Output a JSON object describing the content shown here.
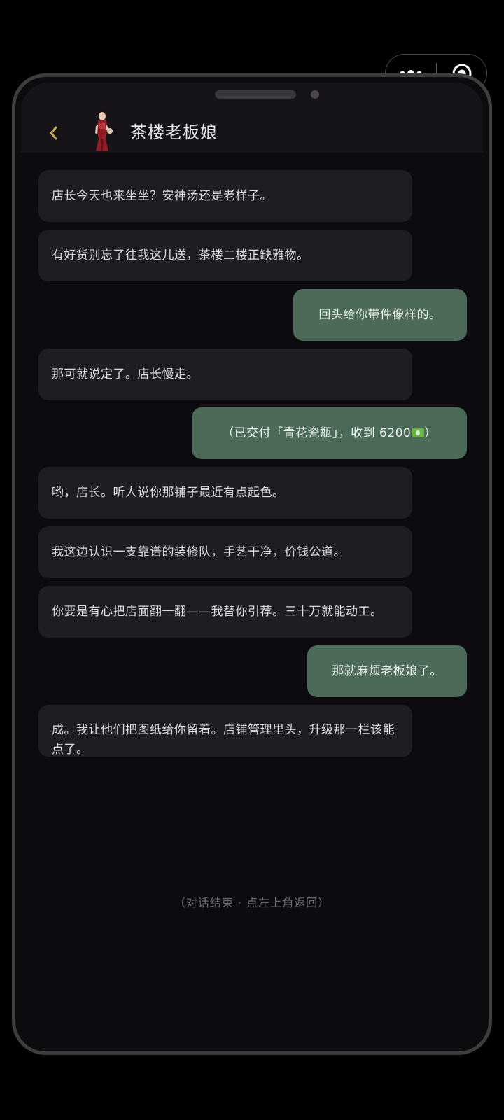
{
  "header": {
    "title": "茶楼老板娘"
  },
  "messages": [
    {
      "side": "left",
      "text": "店长今天也来坐坐？安神汤还是老样子。"
    },
    {
      "side": "left",
      "text": "有好货别忘了往我这儿送，茶楼二楼正缺雅物。"
    },
    {
      "side": "right",
      "text": "回头给你带件像样的。"
    },
    {
      "side": "left",
      "text": "那可就说定了。店长慢走。"
    },
    {
      "side": "right",
      "text": "（已交付「青花瓷瓶」，收到 6200",
      "icon": "money-icon",
      "text_after": "）"
    },
    {
      "side": "left",
      "text": "哟，店长。听人说你那铺子最近有点起色。"
    },
    {
      "side": "left",
      "text": "我这边认识一支靠谱的装修队，手艺干净，价钱公道。"
    },
    {
      "side": "left",
      "text": "你要是有心把店面翻一翻——我替你引荐。三十万就能动工。"
    },
    {
      "side": "right",
      "text": "那就麻烦老板娘了。"
    },
    {
      "side": "left",
      "text": "成。我让他们把图纸给你留着。店铺管理里头，升级那一栏该能点了。"
    }
  ],
  "end_note": "（对话结束 · 点左上角返回）",
  "colors": {
    "background": "#0d0b0f",
    "header": "#161418",
    "left_bubble": "#1f1d21",
    "right_bubble": "#4b6a57",
    "back_arrow": "#c9a85a"
  },
  "icons": {
    "back": "chevron-left-icon",
    "capsule_more": "more-dots-icon",
    "capsule_close": "target-circle-icon"
  }
}
